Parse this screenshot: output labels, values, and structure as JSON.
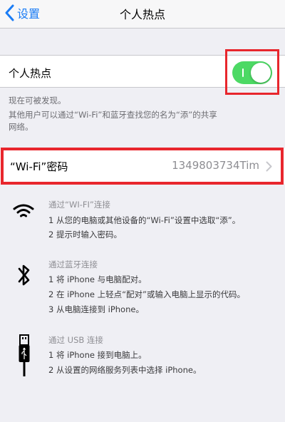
{
  "nav": {
    "back_label": "设置",
    "title": "个人热点"
  },
  "hotspot": {
    "label": "个人热点",
    "enabled": true
  },
  "status": {
    "discoverable": "现在可被发现。",
    "description_line1": "其他用户可以通过“Wi-Fi”和蓝牙查找您的名为“添”的共享",
    "description_line2": "网络。"
  },
  "wifi_password": {
    "label": "“Wi-Fi”密码",
    "value": "1349803734Tim"
  },
  "instructions": {
    "wifi": {
      "icon": "wifi-icon",
      "title": "通过“WI-FI”连接",
      "steps": [
        "1 从您的电脑或其他设备的“Wi-Fi”设置中选取“添”。",
        "2 提示时输入密码。"
      ]
    },
    "bluetooth": {
      "icon": "bluetooth-icon",
      "title": "通过蓝牙连接",
      "steps": [
        "1 将 iPhone 与电脑配对。",
        "2 在 iPhone 上轻点“配对”或输入电脑上显示的代码。",
        "3 从电脑连接到 iPhone。"
      ]
    },
    "usb": {
      "icon": "usb-cable-icon",
      "title": "通过 USB 连接",
      "steps": [
        "1 将 iPhone 接到电脑上。",
        "2 从设置的网络服务列表中选择 iPhone。"
      ]
    }
  },
  "colors": {
    "accent": "#1a7cf5",
    "toggle_on": "#4cd964",
    "highlight": "#e8262d"
  }
}
